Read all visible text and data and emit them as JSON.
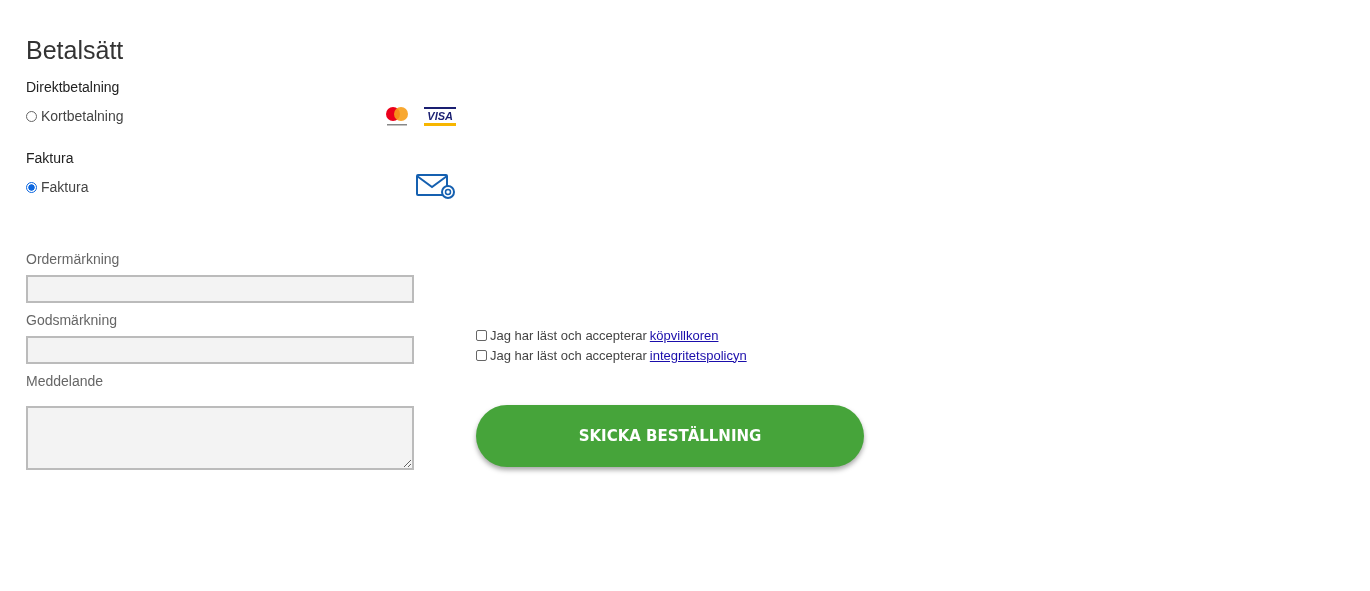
{
  "title": "Betalsätt",
  "payment_groups": [
    {
      "heading": "Direktbetalning",
      "option": {
        "label": "Kortbetalning",
        "selected": false
      },
      "icons": [
        {
          "kind": "mastercard"
        },
        {
          "kind": "visa",
          "text": "VISA"
        }
      ]
    },
    {
      "heading": "Faktura",
      "option": {
        "label": "Faktura",
        "selected": true
      },
      "icons": [
        {
          "kind": "mail"
        }
      ]
    }
  ],
  "fields": [
    {
      "label": "Ordermärkning",
      "kind": "input"
    },
    {
      "label": "Godsmärkning",
      "kind": "input"
    },
    {
      "label": "Meddelande",
      "kind": "textarea"
    }
  ],
  "consents": [
    {
      "text": "Jag har läst och accepterar",
      "link": "köpvillkoren",
      "checked": false
    },
    {
      "text": "Jag har läst och accepterar",
      "link": "integritetspolicyn",
      "checked": false
    }
  ],
  "submit": "SKICKA BESTÄLLNING"
}
